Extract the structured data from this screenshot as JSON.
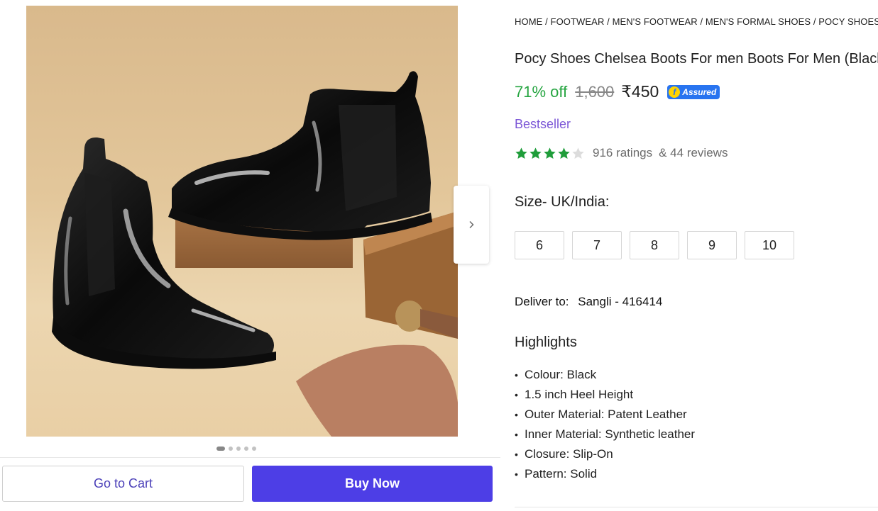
{
  "gallery": {
    "image_alt": "Black patent Chelsea boots",
    "dot_count": 5,
    "active_dot": 0
  },
  "actions": {
    "cart_label": "Go to Cart",
    "buy_label": "Buy Now"
  },
  "breadcrumb": {
    "text": "HOME / FOOTWEAR / MEN'S FOOTWEAR / MEN'S FORMAL SHOES / POCY SHOES MEN'S FORMAL SHOES"
  },
  "product": {
    "title": "Pocy Shoes Chelsea Boots For men Boots For Men (Black)",
    "discount": "71% off",
    "mrp": "1,600",
    "price": "₹450",
    "assured_label": "Assured",
    "tag": "Bestseller",
    "rating_value": 4,
    "ratings_text": "916 ratings",
    "reviews_text": "& 44 reviews"
  },
  "size": {
    "label": "Size- UK/India:",
    "options": [
      "6",
      "7",
      "8",
      "9",
      "10"
    ]
  },
  "delivery": {
    "label": "Deliver to:",
    "location": "Sangli - 416414"
  },
  "highlights": {
    "title": "Highlights",
    "items": [
      "Colour: Black",
      "1.5 inch Heel Height",
      "Outer Material: Patent Leather",
      "Inner Material: Synthetic leather",
      "Closure: Slip-On",
      "Pattern: Solid"
    ]
  },
  "colors": {
    "discount_green": "#26a541",
    "buy_button": "#4d3ee6",
    "tag_purple": "#7b56d6",
    "assured_blue": "#2874f0",
    "star_green": "#1f9d3a"
  }
}
